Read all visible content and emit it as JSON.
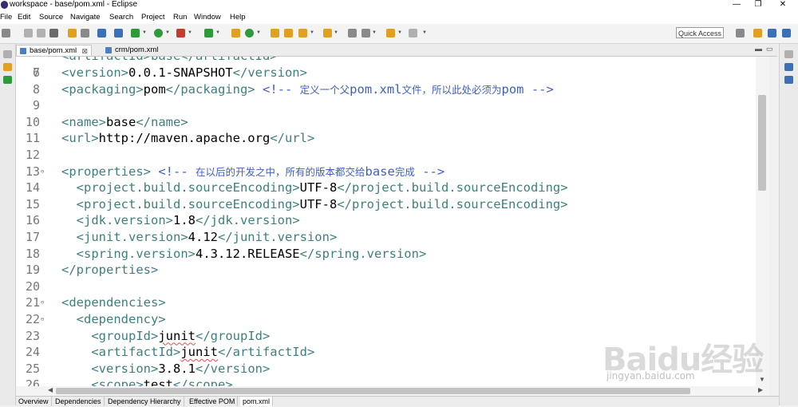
{
  "window": {
    "title": "workspace - base/pom.xml - Eclipse",
    "minimize": "—",
    "restore": "❐",
    "close": "✕"
  },
  "menu": [
    "File",
    "Edit",
    "Source",
    "Navigate",
    "Search",
    "Project",
    "Run",
    "Window",
    "Help"
  ],
  "toolbar": {
    "quick_access": "Quick Access",
    "colors": {
      "green": "#2e9a3a",
      "blue": "#3b6fb6",
      "orange": "#e0a020",
      "red": "#c83b2b",
      "gray": "#8a8a8a"
    }
  },
  "tabs": [
    {
      "label": "base/pom.xml",
      "close": "⊠",
      "active": true
    },
    {
      "label": "crm/pom.xml",
      "close": "",
      "active": false
    }
  ],
  "editor": {
    "partial_top_line": "<artifactId>base</artifactId>",
    "lines": [
      {
        "n": "7",
        "fold": "",
        "parts": [
          [
            "tag",
            "<version>"
          ],
          [
            "txt",
            "0.0.1-SNAPSHOT"
          ],
          [
            "tag",
            "</version>"
          ]
        ]
      },
      {
        "n": "8",
        "fold": "",
        "parts": [
          [
            "tag",
            "<packaging>"
          ],
          [
            "txt",
            "pom"
          ],
          [
            "tag",
            "</packaging>"
          ],
          [
            "txt",
            " "
          ],
          [
            "cmt",
            "<!-- "
          ],
          [
            "cmtcn",
            "定义一个父"
          ],
          [
            "cmt",
            "pom.xml"
          ],
          [
            "cmtcn",
            "文件，所以此处必须为"
          ],
          [
            "cmt",
            "pom -->"
          ]
        ]
      },
      {
        "n": "9",
        "fold": "",
        "parts": []
      },
      {
        "n": "10",
        "fold": "",
        "parts": [
          [
            "tag",
            "<name>"
          ],
          [
            "txt",
            "base"
          ],
          [
            "tag",
            "</name>"
          ]
        ]
      },
      {
        "n": "11",
        "fold": "",
        "parts": [
          [
            "tag",
            "<url>"
          ],
          [
            "txt",
            "http://maven.apache.org"
          ],
          [
            "tag",
            "</url>"
          ]
        ]
      },
      {
        "n": "12",
        "fold": "",
        "parts": []
      },
      {
        "n": "13",
        "fold": "⊖",
        "parts": [
          [
            "tag",
            "<properties>"
          ],
          [
            "txt",
            " "
          ],
          [
            "cmt",
            "<!-- "
          ],
          [
            "cmtcn",
            "在以后的开发之中，所有的版本都交给"
          ],
          [
            "cmt",
            "base"
          ],
          [
            "cmtcn",
            "完成"
          ],
          [
            "cmt",
            " -->"
          ]
        ]
      },
      {
        "n": "14",
        "fold": "",
        "parts": [
          [
            "txt",
            "  "
          ],
          [
            "tag",
            "<project.build.sourceEncoding>"
          ],
          [
            "txt",
            "UTF-8"
          ],
          [
            "tag",
            "</project.build.sourceEncoding>"
          ]
        ]
      },
      {
        "n": "15",
        "fold": "",
        "parts": [
          [
            "txt",
            "  "
          ],
          [
            "tag",
            "<project.build.sourceEncoding>"
          ],
          [
            "txt",
            "UTF-8"
          ],
          [
            "tag",
            "</project.build.sourceEncoding>"
          ]
        ]
      },
      {
        "n": "16",
        "fold": "",
        "parts": [
          [
            "txt",
            "  "
          ],
          [
            "tag",
            "<jdk.version>"
          ],
          [
            "txt",
            "1.8"
          ],
          [
            "tag",
            "</jdk.version>"
          ]
        ]
      },
      {
        "n": "17",
        "fold": "",
        "parts": [
          [
            "txt",
            "  "
          ],
          [
            "tag",
            "<junit.version>"
          ],
          [
            "txt",
            "4.12"
          ],
          [
            "tag",
            "</junit.version>"
          ]
        ]
      },
      {
        "n": "18",
        "fold": "",
        "parts": [
          [
            "txt",
            "  "
          ],
          [
            "tag",
            "<spring.version>"
          ],
          [
            "txt",
            "4.3.12.RELEASE"
          ],
          [
            "tag",
            "</spring.version>"
          ]
        ]
      },
      {
        "n": "19",
        "fold": "",
        "parts": [
          [
            "tag",
            "</properties>"
          ]
        ]
      },
      {
        "n": "20",
        "fold": "",
        "parts": []
      },
      {
        "n": "21",
        "fold": "⊖",
        "parts": [
          [
            "tag",
            "<dependencies>"
          ]
        ]
      },
      {
        "n": "22",
        "fold": "⊖",
        "parts": [
          [
            "txt",
            "  "
          ],
          [
            "tag",
            "<dependency>"
          ]
        ]
      },
      {
        "n": "23",
        "fold": "",
        "parts": [
          [
            "txt",
            "    "
          ],
          [
            "tag",
            "<groupId>"
          ],
          [
            "sq",
            "junit"
          ],
          [
            "tag",
            "</groupId>"
          ]
        ]
      },
      {
        "n": "24",
        "fold": "",
        "parts": [
          [
            "txt",
            "    "
          ],
          [
            "tag",
            "<artifactId>"
          ],
          [
            "sq",
            "junit"
          ],
          [
            "tag",
            "</artifactId>"
          ]
        ]
      },
      {
        "n": "25",
        "fold": "",
        "parts": [
          [
            "txt",
            "    "
          ],
          [
            "tag",
            "<version>"
          ],
          [
            "txt",
            "3.8.1"
          ],
          [
            "tag",
            "</version>"
          ]
        ]
      },
      {
        "n": "26",
        "fold": "",
        "parts": [
          [
            "txt",
            "    "
          ],
          [
            "tag",
            "<scope>"
          ],
          [
            "txt",
            "test"
          ],
          [
            "tag",
            "</scope>"
          ]
        ]
      }
    ]
  },
  "bottom_tabs": [
    "Overview",
    "Dependencies",
    "Dependency Hierarchy",
    "Effective POM",
    "pom.xml"
  ],
  "watermark": {
    "logo": "Baidu经验",
    "url": "jingyan.baidu.com"
  }
}
